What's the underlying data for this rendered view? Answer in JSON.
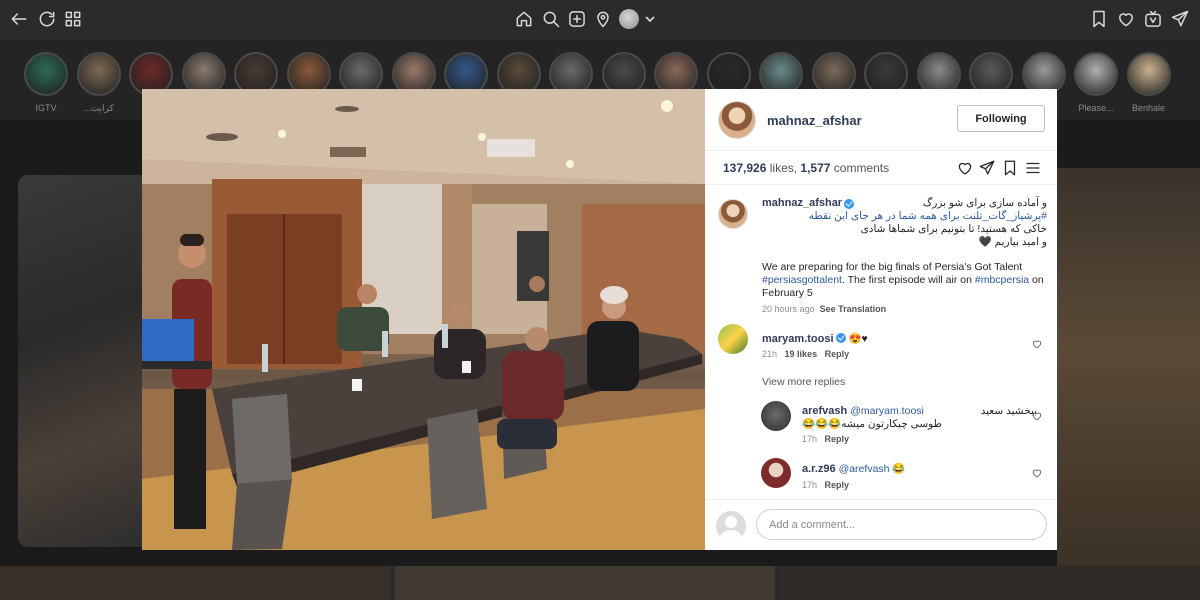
{
  "toolbar": {
    "icons": [
      "back-arrow-icon",
      "refresh-icon",
      "grid-icon",
      "home-icon",
      "search-icon",
      "new-post-icon",
      "location-icon",
      "avatar",
      "chevron-down-icon",
      "bookmark-icon",
      "heart-icon",
      "igtv-icon",
      "send-icon"
    ]
  },
  "stories": {
    "items": [
      {
        "label": "IGTV"
      },
      {
        "label": "...کرایت"
      },
      {
        "label": ""
      },
      {
        "label": ""
      },
      {
        "label": ""
      },
      {
        "label": ""
      },
      {
        "label": ""
      },
      {
        "label": ""
      },
      {
        "label": ""
      },
      {
        "label": ""
      },
      {
        "label": ""
      },
      {
        "label": ""
      },
      {
        "label": ""
      },
      {
        "label": ""
      },
      {
        "label": ""
      },
      {
        "label": ""
      },
      {
        "label": ""
      },
      {
        "label": ""
      },
      {
        "label": ""
      },
      {
        "label": ""
      },
      {
        "label": "Please..."
      },
      {
        "label": "Benhale"
      }
    ]
  },
  "post": {
    "author": "mahnaz_afshar",
    "follow_label": "Following",
    "likes_count": "137,926",
    "likes_label": "likes",
    "comments_count": "1,577",
    "comments_label": "comments",
    "caption": {
      "user": "mahnaz_afshar",
      "line1": "و آماده سازی برای شو بزرگ",
      "line2": "#پرشیاز_گات_تلنت برای همه شما در هر جای این نقطه",
      "line3": "خاکی که هستید! تا بتونیم برای شماها شادی",
      "line4": "و امید بیاریم 🖤",
      "english_prefix": "We are preparing for the big finals of Persia's Got Talent ",
      "hashtag1": "#persiasgottalent",
      "english_mid": ". The first episode will air on ",
      "hashtag2": "#mbcpersia",
      "english_suffix": " on February 5",
      "time": "20 hours ago",
      "see_translation": "See Translation"
    },
    "comments": [
      {
        "user": "maryam.toosi",
        "text": "😍♥",
        "time": "21h",
        "likes": "19 likes",
        "reply": "Reply"
      },
      {
        "user": "arefvash",
        "mention": "@maryam.toosi",
        "text": "ببخشید سعید",
        "text2": "طوسی چیکارتون میشه😂😂😂",
        "time": "17h",
        "reply": "Reply"
      },
      {
        "user": "a.r.z96",
        "mention": "@arefvash",
        "text": "😂",
        "time": "17h",
        "reply": "Reply"
      }
    ],
    "view_more_replies": "View more replies",
    "add_comment_placeholder": "Add a comment..."
  }
}
